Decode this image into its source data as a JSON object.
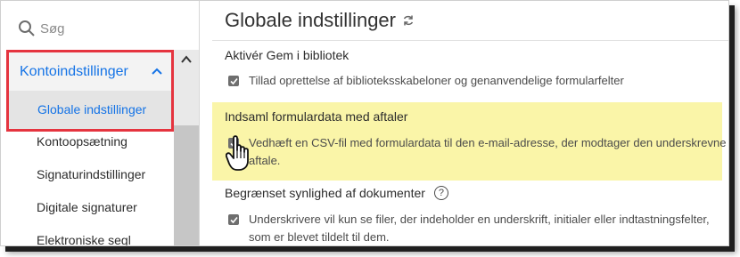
{
  "search": {
    "placeholder": "Søg"
  },
  "sidebar": {
    "group_label": "Kontoindstillinger",
    "active_item": "Globale indstillinger",
    "items": [
      {
        "label": "Kontoopsætning"
      },
      {
        "label": "Signaturindstillinger"
      },
      {
        "label": "Digitale signaturer"
      },
      {
        "label": "Elektroniske segl"
      }
    ]
  },
  "main": {
    "title": "Globale indstillinger",
    "sections": [
      {
        "heading": "Aktivér Gem i bibliotek",
        "option": "Tillad oprettelse af biblioteksskabeloner og genanvendelige formularfelter"
      },
      {
        "heading": "Indsaml formulardata med aftaler",
        "option_line1": "Vedhæft en CSV-fil med formulardata til den e-mail-adresse, der modtager den underskrevne",
        "option_line2": "aftale."
      },
      {
        "heading": "Begrænset synlighed af dokumenter",
        "help": "?",
        "option_line1": "Underskrivere vil kun se filer, der indeholder en underskrift, initialer eller indtastningsfelter,",
        "option_line2": "som er blevet tildelt til dem."
      }
    ]
  },
  "colors": {
    "accent": "#1473e6",
    "highlight": "#faf5a8",
    "callout": "#e5343f"
  },
  "icons": [
    "search-icon",
    "chevron-up-icon",
    "refresh-icon",
    "checkbox-checked-icon",
    "help-icon",
    "hand-cursor-icon"
  ]
}
